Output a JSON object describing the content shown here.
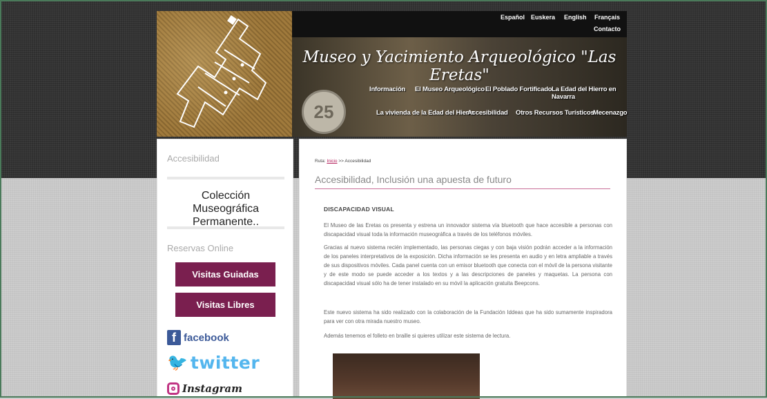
{
  "header": {
    "languages": [
      "Español",
      "Euskera",
      "English",
      "Français"
    ],
    "contact": "Contacto",
    "site_title": "Museo y Yacimiento Arqueológico \"Las Eretas\"",
    "seal_number": "25",
    "nav_row1": [
      "Información",
      "El Museo Arqueológico",
      "El Poblado Fortificado",
      "La Edad del Hierro en Navarra"
    ],
    "nav_row2": [
      "La vivienda de la Edad del Hierro",
      "Accesibilidad",
      "Otros Recursos Turísticos",
      "Mecenazgo"
    ]
  },
  "sidebar": {
    "heading1": "Accesibilidad",
    "collection_link": "Colección Museográfica Permanente..",
    "heading2": "Reservas Online",
    "buttons": [
      "Visitas Guiadas",
      "Visitas Libres"
    ],
    "social": {
      "facebook": "facebook",
      "twitter": "twitter",
      "instagram": "Instagram"
    }
  },
  "main": {
    "breadcrumb_prefix": "Ruta:",
    "breadcrumb_home": "Inicio",
    "breadcrumb_rest": ">> Accesibilidad",
    "title": "Accesibilidad, Inclusión una apuesta de futuro",
    "section_heading": "DISCAPACIDAD VISUAL",
    "paragraphs": [
      "El Museo de las Eretas os presenta y estrena un innovador sistema vía bluetooth que hace accesible a personas con discapacidad visual toda la información museográfica a través de los teléfonos móviles.",
      "Gracias al nuevo sistema recién  implementado, las personas ciegas y con baja visión podrán acceder a la información de los paneles interpretativos de la exposición. Dicha información se les presenta en audio y en letra ampliable a través de sus dispositivos móviles. Cada panel cuenta con un emisor bluetooth que conecta con el móvil de la persona visitante y de este modo se puede acceder a los textos y a las descripciones de paneles y maquetas. La persona con discapacidad visual sólo ha de tener instalado en su móvil la aplicación gratuita Beepcons.",
      "Este nuevo sistema ha sido realizado con la colaboración de la Fundación Iddeas que ha sido sumamente inspiradora para ver con otra mirada nuestro museo.",
      "Además tenemos el folleto en braille si quieres utilizar este sistema de lectura."
    ]
  },
  "colors": {
    "accent": "#7a1f4f",
    "link": "#b31e5a",
    "facebook": "#3b5998",
    "twitter": "#1da1f2"
  }
}
